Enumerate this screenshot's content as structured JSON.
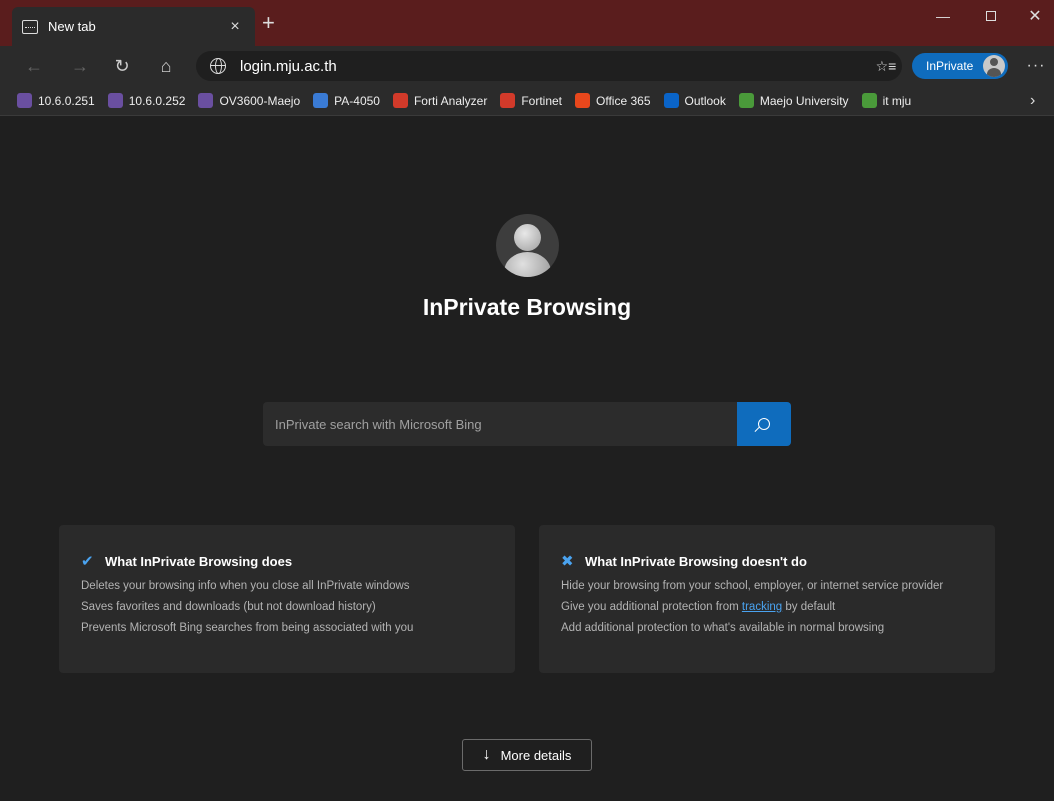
{
  "tab": {
    "title": "New tab",
    "close": "×",
    "new_tab": "+"
  },
  "window": {
    "minimize": "—",
    "close": "✕"
  },
  "nav": {
    "back": "←",
    "forward": "→",
    "refresh": "↻",
    "home": "⌂",
    "url": "login.mju.ac.th",
    "favorites_icon": "☆≡",
    "inprivate_label": "InPrivate",
    "menu": "···"
  },
  "favorites": [
    {
      "label": "10.6.0.251",
      "icon": "aruba-icon",
      "color": "#6a4fa0"
    },
    {
      "label": "10.6.0.252",
      "icon": "aruba-icon",
      "color": "#6a4fa0"
    },
    {
      "label": "OV3600-Maejo",
      "icon": "aruba-icon",
      "color": "#6a4fa0"
    },
    {
      "label": "PA-4050",
      "icon": "paloalto-icon",
      "color": "#3a7bd5"
    },
    {
      "label": "Forti Analyzer",
      "icon": "fortinet-icon",
      "color": "#d23a2a"
    },
    {
      "label": "Fortinet",
      "icon": "fortinet-icon",
      "color": "#d23a2a"
    },
    {
      "label": "Office 365",
      "icon": "office-icon",
      "color": "#e8471c"
    },
    {
      "label": "Outlook",
      "icon": "outlook-icon",
      "color": "#0a64c8"
    },
    {
      "label": "Maejo University",
      "icon": "maejo-icon",
      "color": "#4a9a3a"
    },
    {
      "label": "it mju",
      "icon": "maejo-icon",
      "color": "#4a9a3a"
    }
  ],
  "favorites_more": "›",
  "page": {
    "title": "InPrivate Browsing",
    "search_placeholder": "InPrivate search with Microsoft Bing",
    "does": {
      "title": "What InPrivate Browsing does",
      "lines": [
        "Deletes your browsing info when you close all InPrivate windows",
        "Saves favorites and downloads (but not download history)",
        "Prevents Microsoft Bing searches from being associated with you"
      ]
    },
    "doesnt": {
      "title": "What InPrivate Browsing doesn't do",
      "line1": "Hide your browsing from your school, employer, or internet service provider",
      "line2_pre": "Give you additional protection from ",
      "line2_link": "tracking",
      "line2_post": " by default",
      "line3": "Add additional protection to what's available in normal browsing"
    },
    "more_details": "More details",
    "more_arrow": "↓"
  },
  "colors": {
    "titlebar": "#5a1d1d",
    "accent": "#0f6cbd",
    "link": "#4aa3f0"
  }
}
